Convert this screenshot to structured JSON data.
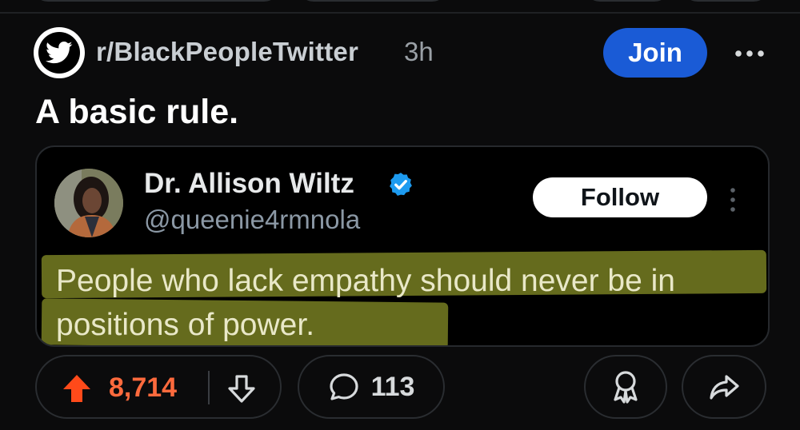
{
  "post": {
    "subreddit": "r/BlackPeopleTwitter",
    "time": "3h",
    "join_label": "Join",
    "title": "A basic rule."
  },
  "tweet": {
    "author_name": "Dr. Allison Wiltz",
    "handle": "@queenie4rmnola",
    "follow_label": "Follow",
    "text": "People who lack empathy should never be in positions of power."
  },
  "actions": {
    "upvotes": "8,714",
    "comments": "113"
  },
  "colors": {
    "background": "#0b0b0c",
    "join": "#1a5bd6",
    "upvote": "#ff6a3d",
    "verified": "#1d9bf0",
    "highlight": "#6e7420"
  },
  "icons": [
    "twitter-bird-icon",
    "more-horizontal-icon",
    "verified-badge-icon",
    "more-vertical-icon",
    "upvote-arrow-icon",
    "downvote-arrow-icon",
    "comment-bubble-icon",
    "award-icon",
    "share-arrow-icon"
  ]
}
